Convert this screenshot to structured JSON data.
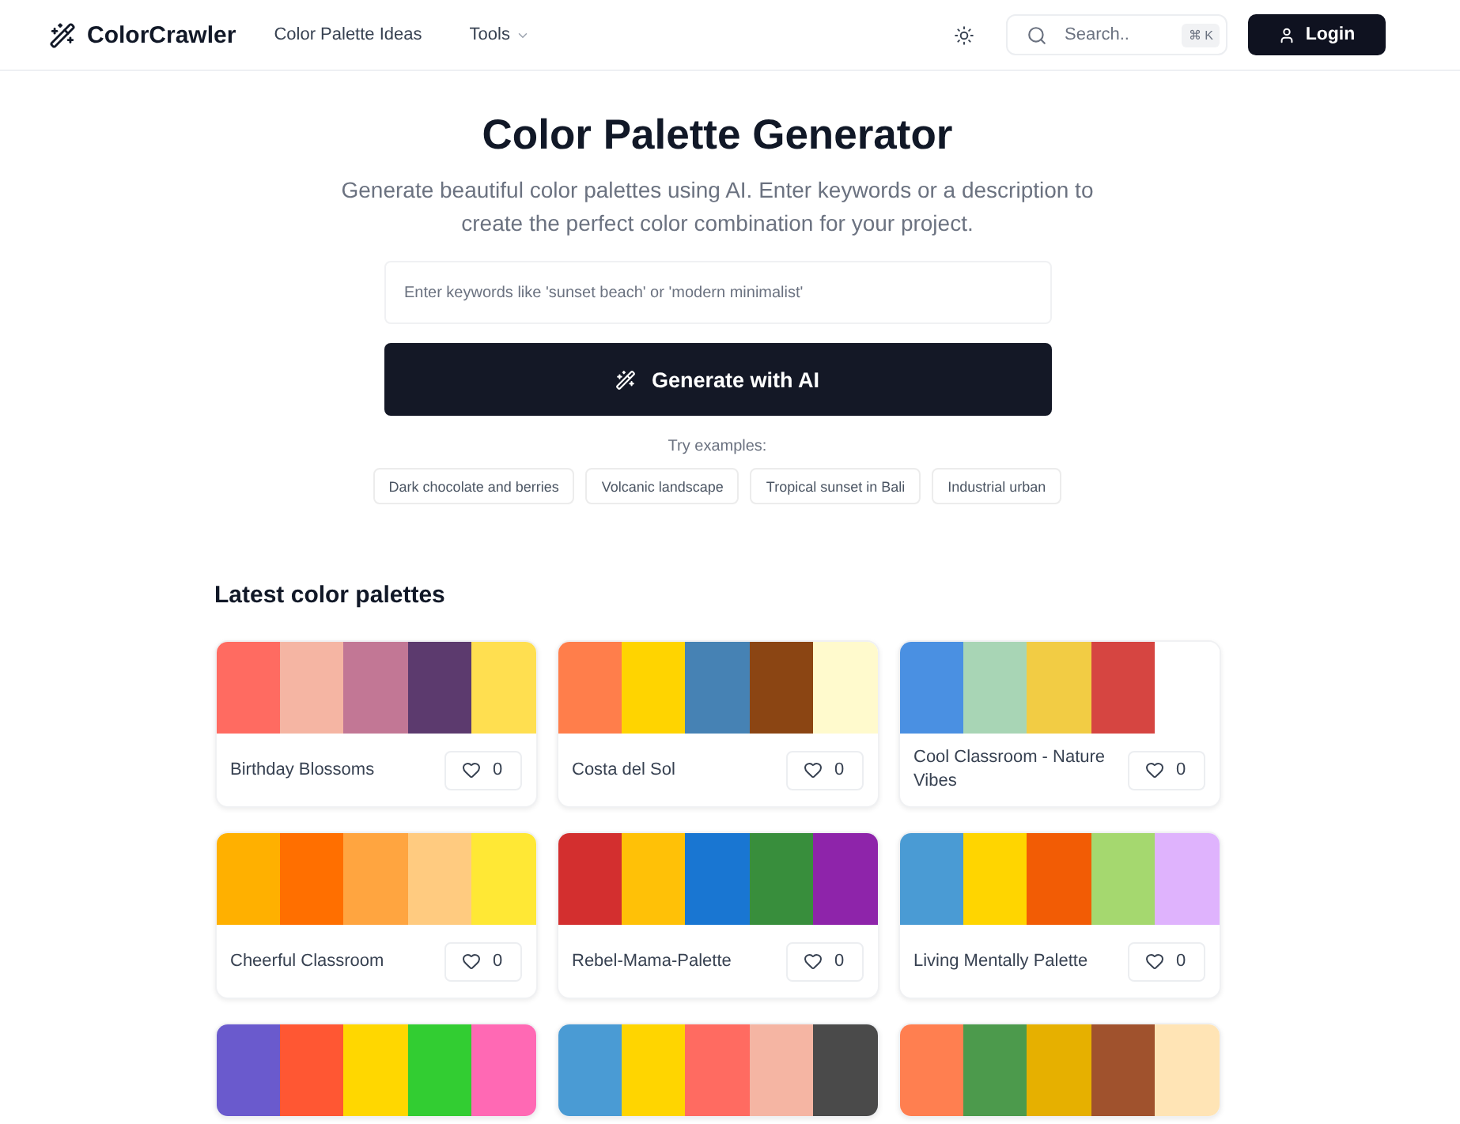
{
  "header": {
    "logo": "ColorCrawler",
    "nav": [
      {
        "label": "Color Palette Ideas",
        "kind": "link"
      },
      {
        "label": "Tools",
        "kind": "dropdown"
      }
    ],
    "search": {
      "placeholder": "Search..",
      "shortcut": "⌘ K"
    },
    "login_button": "Login"
  },
  "hero": {
    "title": "Color Palette Generator",
    "subtitle": "Generate beautiful color palettes using AI. Enter keywords or a description to create the perfect color combination for your project.",
    "input": {
      "placeholder": "Enter keywords like 'sunset beach' or 'modern minimalist'"
    },
    "generate_button": "Generate with AI",
    "examples_label": "Try examples:",
    "examples": [
      "Dark chocolate and berries",
      "Volcanic landscape",
      "Tropical sunset in Bali",
      "Industrial urban"
    ]
  },
  "palettes": {
    "title": "Latest color palettes",
    "cards": [
      {
        "name": "Birthday Blossoms",
        "likes": "0",
        "swatches": [
          {
            "color": "#ff6b61"
          },
          {
            "color": "#f5b5a3"
          },
          {
            "color": "#c27795"
          },
          {
            "color": "#5c3a6e"
          },
          {
            "color": "#ffdf50"
          }
        ]
      },
      {
        "name": "Costa del Sol",
        "likes": "0",
        "swatches": [
          {
            "color": "#ff7e4b"
          },
          {
            "color": "#ffd400"
          },
          {
            "color": "#4682b4"
          },
          {
            "color": "#8b4513"
          },
          {
            "color": "#fffacd"
          }
        ]
      },
      {
        "name": "Cool Classroom - Nature Vibes",
        "likes": "0",
        "swatches": [
          {
            "color": "#4a90e2"
          },
          {
            "color": "#a8d5b5"
          },
          {
            "color": "#f2cc44"
          },
          {
            "color": "#d64541"
          },
          {
            "color": "#ffffff"
          }
        ]
      },
      {
        "name": "Cheerful Classroom",
        "likes": "0",
        "swatches": [
          {
            "color": "#ffb000"
          },
          {
            "color": "#ff6f00"
          },
          {
            "color": "#ffa540"
          },
          {
            "color": "#ffcb80"
          },
          {
            "color": "#ffe835"
          }
        ]
      },
      {
        "name": "Rebel-Mama-Palette",
        "likes": "0",
        "swatches": [
          {
            "color": "#d32f2f"
          },
          {
            "color": "#ffc107"
          },
          {
            "color": "#1976d2"
          },
          {
            "color": "#388e3c"
          },
          {
            "color": "#8e24aa"
          }
        ]
      },
      {
        "name": "Living Mentally Palette",
        "likes": "0",
        "swatches": [
          {
            "color": "#4a9bd4"
          },
          {
            "color": "#ffd500"
          },
          {
            "color": "#f25c05"
          },
          {
            "color": "#a5d86f"
          },
          {
            "color": "#dfb3fd"
          }
        ]
      },
      {
        "swatches": [
          {
            "color": "#6a5acd"
          },
          {
            "color": "#ff5733"
          },
          {
            "color": "#ffd700"
          },
          {
            "color": "#32cd32"
          },
          {
            "color": "#ff69b4"
          }
        ]
      },
      {
        "swatches": [
          {
            "color": "#4a9bd4"
          },
          {
            "color": "#ffd500"
          },
          {
            "color": "#ff6b61"
          },
          {
            "color": "#f5b5a3"
          },
          {
            "color": "#4a4a4a"
          }
        ]
      },
      {
        "swatches": [
          {
            "color": "#ff7f50"
          },
          {
            "color": "#4c9a4c"
          },
          {
            "color": "#e6b000"
          },
          {
            "color": "#a0522d"
          },
          {
            "color": "#ffe4b5"
          }
        ]
      }
    ]
  }
}
